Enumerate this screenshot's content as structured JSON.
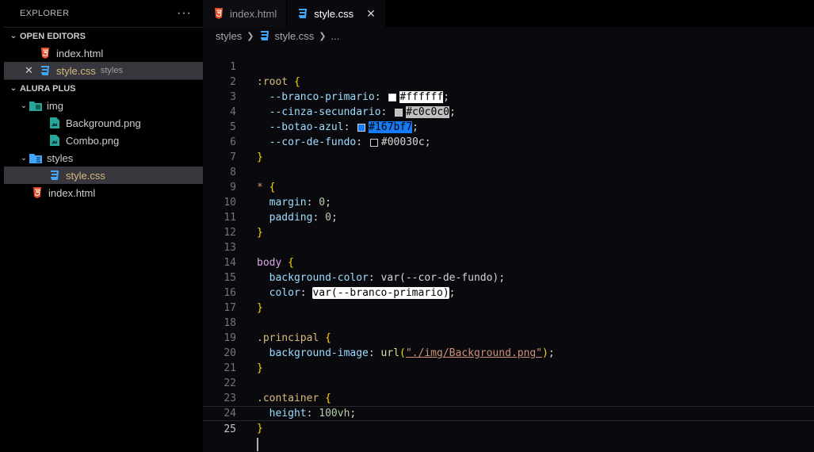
{
  "explorer": {
    "title": "EXPLORER",
    "more": "···",
    "open_editors": {
      "label": "OPEN EDITORS",
      "items": [
        {
          "name": "index.html"
        },
        {
          "name": "style.css",
          "desc": "styles"
        }
      ]
    },
    "project": {
      "label": "ALURA PLUS",
      "img_folder": "img",
      "img_files": [
        "Background.png",
        "Combo.png"
      ],
      "styles_folder": "styles",
      "styles_files": [
        "style.css"
      ],
      "root_files": [
        "index.html"
      ]
    }
  },
  "tabs": [
    {
      "label": "index.html"
    },
    {
      "label": "style.css",
      "close": "✕"
    }
  ],
  "breadcrumb": {
    "folder": "styles",
    "file": "style.css",
    "more": "..."
  },
  "editor": {
    "line_numbers": [
      "1",
      "2",
      "3",
      "4",
      "5",
      "6",
      "7",
      "8",
      "9",
      "10",
      "11",
      "12",
      "13",
      "14",
      "15",
      "16",
      "17",
      "18",
      "19",
      "20",
      "21",
      "22",
      "23",
      "24",
      "25"
    ],
    "code": {
      "l1_sel": ":root",
      "open_brace": "{",
      "close_brace": "}",
      "l2_prop": "--branco-primario",
      "l2_val": "#ffffff",
      "l3_prop": "--cinza-secundario",
      "l3_val": "#c0c0c0",
      "l4_prop": "--botao-azul",
      "l4_val": "#167bf7",
      "l5_prop": "--cor-de-fundo",
      "l5_val": "#00030c",
      "l8_sel": "*",
      "l9_prop": "margin",
      "l9_val": "0",
      "l10_prop": "padding",
      "l10_val": "0",
      "l13_sel": "body",
      "l14_prop": "background-color",
      "l14_val": "var(--cor-de-fundo)",
      "l15_prop": "color",
      "l15_val": "var(--branco-primario)",
      "l18_sel": ".principal",
      "l19_prop": "background-image",
      "l19_fn": "url",
      "l19_str": "\"./img/Background.png\"",
      "l22_sel": ".container",
      "l23_prop": "height",
      "l23_val": "100vh",
      "colon": ":",
      "semi": ";"
    }
  },
  "colors": {
    "branco": "#ffffff",
    "cinza": "#c0c0c0",
    "azul": "#167bf7",
    "fundo": "#00030c",
    "html_icon": "#e44d26",
    "css_icon": "#42a5f5",
    "img_icon": "#26a69a"
  }
}
